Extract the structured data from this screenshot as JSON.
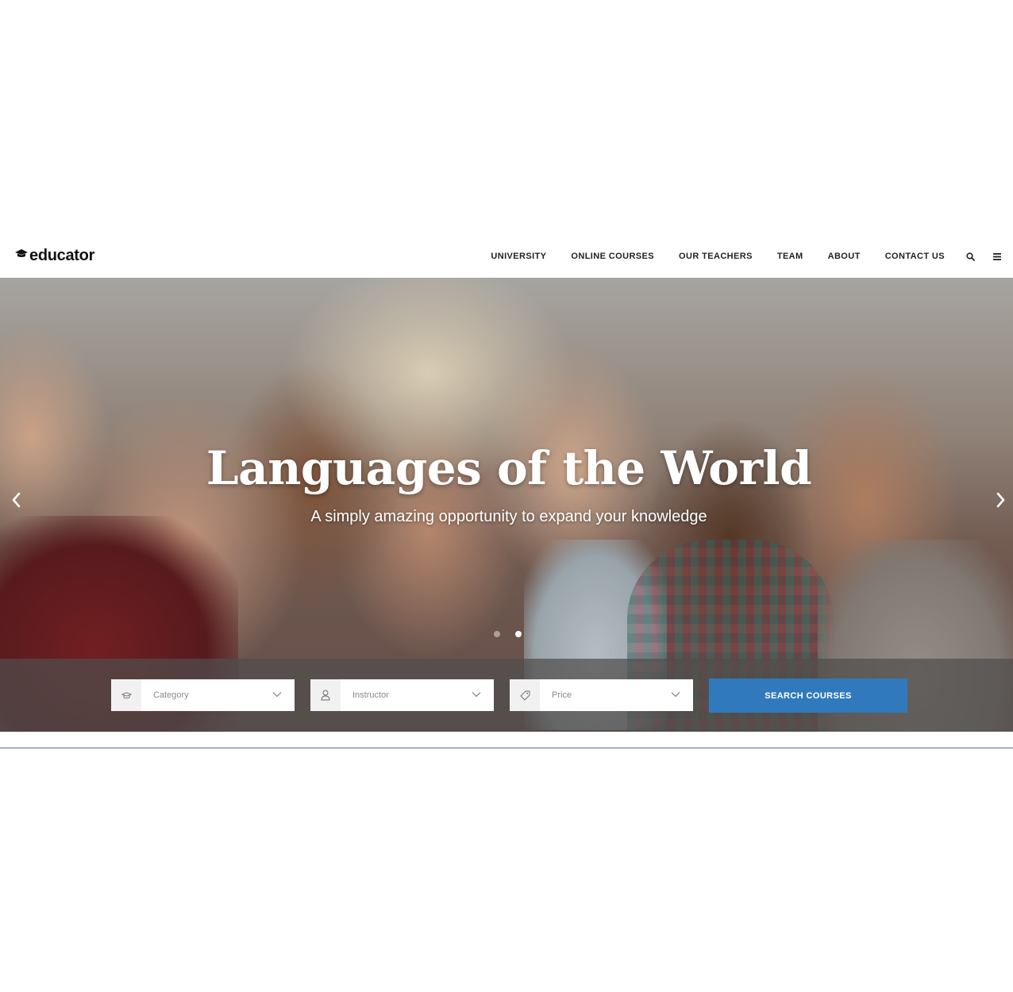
{
  "header": {
    "logo_text": "educator",
    "nav": [
      {
        "label": "UNIVERSITY"
      },
      {
        "label": "ONLINE COURSES"
      },
      {
        "label": "OUR TEACHERS"
      },
      {
        "label": "TEAM"
      },
      {
        "label": "ABOUT"
      },
      {
        "label": "CONTACT US"
      }
    ],
    "icons": [
      "search-icon",
      "menu-icon"
    ]
  },
  "hero": {
    "title": "Languages of the World",
    "subtitle": "A simply amazing opportunity to expand your knowledge",
    "slides_total": 2,
    "active_slide": 2
  },
  "search": {
    "fields": [
      {
        "label": "Category",
        "icon": "graduation-cap-icon"
      },
      {
        "label": "Instructor",
        "icon": "user-icon"
      },
      {
        "label": "Price",
        "icon": "price-tag-icon"
      }
    ],
    "button_label": "SEARCH COURSES"
  },
  "colors": {
    "accent": "#3179bd",
    "nav_text": "#222222",
    "band_overlay": "rgba(80,78,76,0.72)",
    "rule": "#4a69a8"
  }
}
